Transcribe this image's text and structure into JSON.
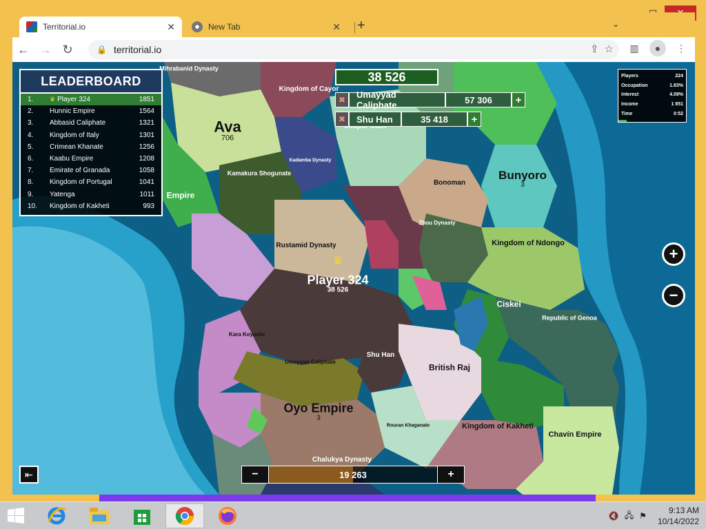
{
  "window": {
    "controls": {
      "minimize": "—",
      "maximize": "□",
      "close": "✕"
    }
  },
  "browser": {
    "tabs": [
      {
        "title": "Territorial.io",
        "favicon": "territorial-favicon",
        "active": true
      },
      {
        "title": "New Tab",
        "favicon": "chrome-favicon",
        "active": false
      }
    ],
    "url": "territorial.io"
  },
  "leaderboard": {
    "title": "LEADERBOARD",
    "rows": [
      {
        "rank": "1.",
        "name": "Player 324",
        "value": "1851"
      },
      {
        "rank": "2.",
        "name": "Hunnic Empire",
        "value": "1564"
      },
      {
        "rank": "3.",
        "name": "Abbasid Caliphate",
        "value": "1321"
      },
      {
        "rank": "4.",
        "name": "Kingdom of Italy",
        "value": "1301"
      },
      {
        "rank": "5.",
        "name": "Crimean Khanate",
        "value": "1256"
      },
      {
        "rank": "6.",
        "name": "Kaabu Empire",
        "value": "1208"
      },
      {
        "rank": "7.",
        "name": "Emirate of Granada",
        "value": "1058"
      },
      {
        "rank": "8.",
        "name": "Kingdom of Portugal",
        "value": "1041"
      },
      {
        "rank": "9.",
        "name": "Yatenga",
        "value": "1011"
      },
      {
        "rank": "10.",
        "name": "Kingdom of Kakheti",
        "value": "993"
      }
    ]
  },
  "balance": "38 526",
  "attacks": [
    {
      "target": "Umayyad Caliphate",
      "troops": "57 306"
    },
    {
      "target": "Shu Han",
      "troops": "35 418"
    }
  ],
  "stats": [
    {
      "label": "Players",
      "value": "224"
    },
    {
      "label": "Occupation",
      "value": "1.83%"
    },
    {
      "label": "Interest",
      "value": "4.09%"
    },
    {
      "label": "Income",
      "value": "1 851"
    },
    {
      "label": "Time",
      "value": "0:52"
    }
  ],
  "zoom": {
    "in": "+",
    "out": "−"
  },
  "troop_slider": {
    "value": "19 263",
    "fraction": 0.5,
    "minus": "−",
    "plus": "+"
  },
  "map_labels": [
    {
      "name": "Ava",
      "sub": "706",
      "key": "ava"
    },
    {
      "name": "Kingdom of Cayor",
      "sub": "",
      "key": "cayor"
    },
    {
      "name": "Mihrabanid Dynasty",
      "sub": "",
      "key": "mihrabanid"
    },
    {
      "name": "Kadamba Dynasty",
      "sub": "",
      "key": "kadamba"
    },
    {
      "name": "Kamakura Shogunate",
      "sub": "",
      "key": "kamakura"
    },
    {
      "name": "Empire",
      "sub": "",
      "key": "empire"
    },
    {
      "name": "Udupur State",
      "sub": "",
      "key": "udupur"
    },
    {
      "name": "Bunyoro",
      "sub": "3",
      "key": "bunyoro"
    },
    {
      "name": "Bonoman",
      "sub": "",
      "key": "bonoman"
    },
    {
      "name": "Zhou Dynasty",
      "sub": "",
      "key": "zhou"
    },
    {
      "name": "Rustamid Dynasty",
      "sub": "",
      "key": "rustamid"
    },
    {
      "name": "Kingdom of Ndongo",
      "sub": "",
      "key": "ndongo"
    },
    {
      "name": "Player 324",
      "sub": "38 526",
      "key": "player"
    },
    {
      "name": "Ciskei",
      "sub": "",
      "key": "ciskei"
    },
    {
      "name": "Republic of Genoa",
      "sub": "",
      "key": "genoa"
    },
    {
      "name": "Kara Koyunlu",
      "sub": "",
      "key": "kara"
    },
    {
      "name": "Shu Han",
      "sub": "",
      "key": "shuhan"
    },
    {
      "name": "Umayyad Caliphate",
      "sub": "",
      "key": "umayyad"
    },
    {
      "name": "British Raj",
      "sub": "",
      "key": "britishraj"
    },
    {
      "name": "Oyo Empire",
      "sub": "3",
      "key": "oyo"
    },
    {
      "name": "Rouran Khaganate",
      "sub": "",
      "key": "rouran"
    },
    {
      "name": "Kingdom of Kakheti",
      "sub": "",
      "key": "kakheti"
    },
    {
      "name": "Chavín Empire",
      "sub": "",
      "key": "chavin"
    },
    {
      "name": "Chalukya Dynasty",
      "sub": "",
      "key": "chalukya"
    }
  ],
  "taskbar": {
    "apps": [
      "internet-explorer-icon",
      "file-explorer-icon",
      "store-icon",
      "chrome-icon",
      "firefox-icon"
    ],
    "time": "9:13 AM",
    "date": "10/14/2022"
  },
  "colors": {
    "ocean": "#0d5f86",
    "coast": "#2fb3d6",
    "player": "#4a3a3a",
    "leaderboard_top": "#2e7d32"
  }
}
